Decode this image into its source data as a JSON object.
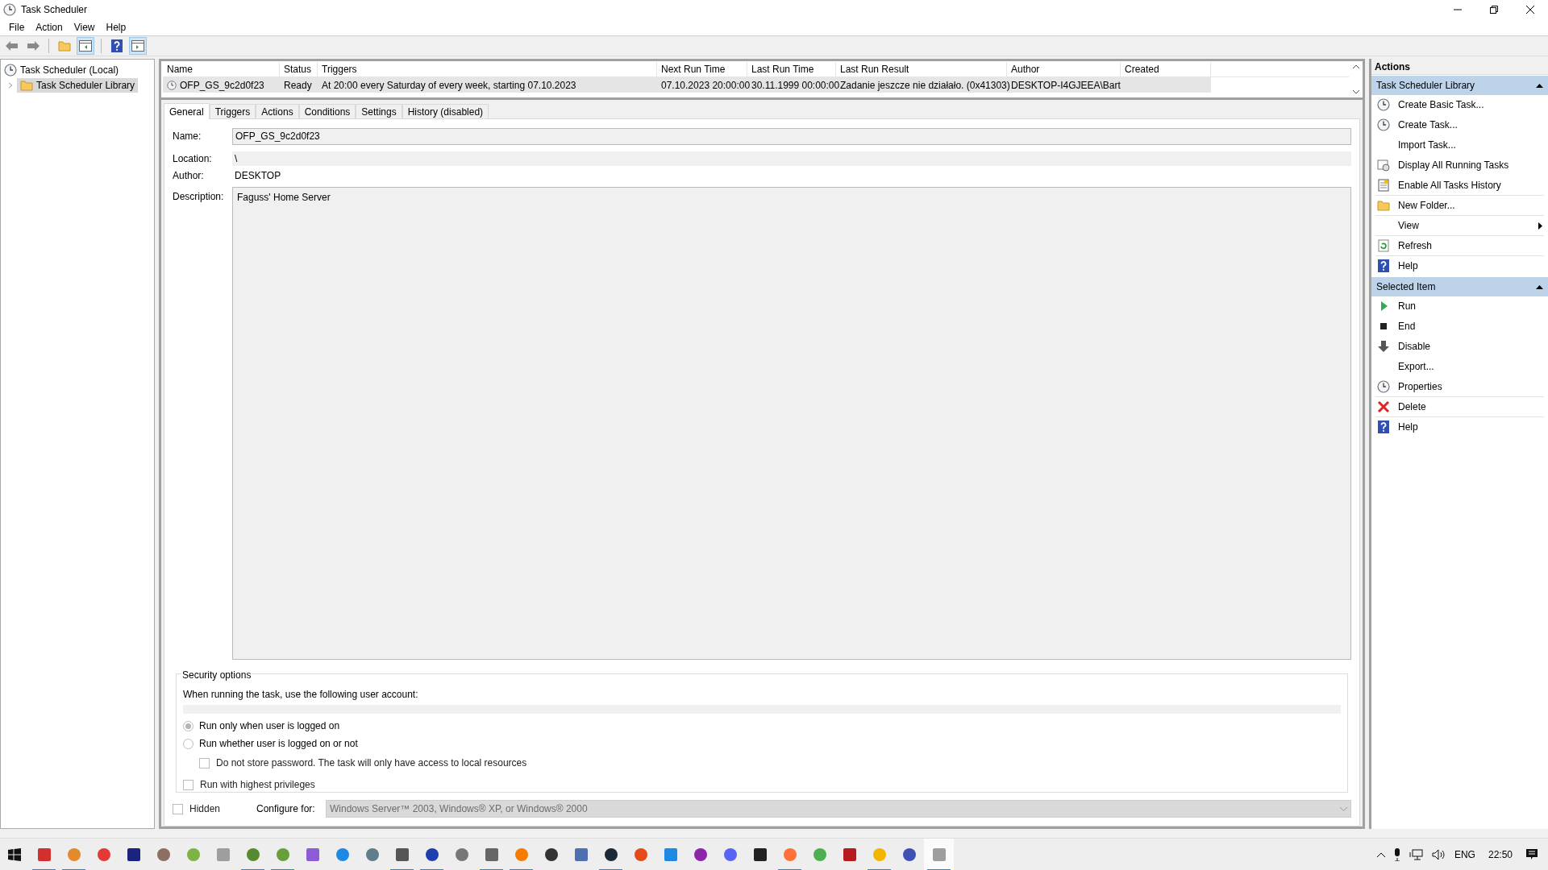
{
  "window": {
    "title": "Task Scheduler"
  },
  "menu": [
    "File",
    "Action",
    "View",
    "Help"
  ],
  "tree": {
    "label": "Task Scheduler (Local)",
    "children": [
      {
        "label": "Task Scheduler Library",
        "selected": true,
        "expanded": false
      }
    ]
  },
  "table": {
    "columns": [
      "Name",
      "Status",
      "Triggers",
      "Next Run Time",
      "Last Run Time",
      "Last Run Result",
      "Author",
      "Created"
    ],
    "rows": [
      {
        "selected": true,
        "cells": [
          "OFP_GS_9c2d0f23",
          "Ready",
          "At 20:00 every Saturday of every week, starting 07.10.2023",
          "07.10.2023 20:00:00",
          "30.11.1999 00:00:00",
          "Zadanie jeszcze nie działało. (0x41303)",
          "DESKTOP-I4GJEEA\\Bart"
        ]
      }
    ]
  },
  "tabs": [
    {
      "label": "General",
      "selected": true
    },
    {
      "label": "Triggers",
      "selected": false
    },
    {
      "label": "Actions",
      "selected": false
    },
    {
      "label": "Conditions",
      "selected": false
    },
    {
      "label": "Settings",
      "selected": false
    },
    {
      "label": "History (disabled)",
      "selected": false
    }
  ],
  "general": {
    "name_label": "Name:",
    "name": "OFP_GS_9c2d0f23",
    "location_label": "Location:",
    "location": "\\",
    "author_label": "Author:",
    "author": "DESKTOP",
    "description_label": "Description:",
    "description": "Faguss' Home Server",
    "security": {
      "title": "Security options",
      "account_label": "When running the task, use the following user account:",
      "radios": [
        {
          "label": "Run only when user is logged on",
          "selected": true
        },
        {
          "label": "Run whether user is logged on or not",
          "selected": false
        }
      ],
      "store_password": {
        "label": "Do not store password.  The task will only have access to local resources",
        "checked": false
      },
      "highest": {
        "label": "Run with highest privileges",
        "checked": false
      }
    },
    "hidden": {
      "label": "Hidden",
      "checked": false
    },
    "configure_label": "Configure for:",
    "configure": "Windows Server™ 2003, Windows® XP, or Windows® 2000"
  },
  "actions": {
    "title": "Actions",
    "sections": [
      {
        "title": "Task Scheduler Library",
        "expanded": true,
        "items": [
          {
            "label": "Create Basic Task...",
            "kind": "wizard",
            "divider": false
          },
          {
            "label": "Create Task...",
            "kind": "task",
            "divider": false
          },
          {
            "label": "Import Task...",
            "kind": "plain",
            "divider": false
          },
          {
            "label": "Display All Running Tasks",
            "kind": "running",
            "divider": false
          },
          {
            "label": "Enable All Tasks History",
            "kind": "history",
            "divider": true
          },
          {
            "label": "New Folder...",
            "kind": "folder",
            "divider": true
          },
          {
            "label": "View",
            "kind": "submenu",
            "divider": true
          },
          {
            "label": "Refresh",
            "kind": "refresh",
            "divider": true
          },
          {
            "label": "Help",
            "kind": "help",
            "divider": false
          }
        ]
      },
      {
        "title": "Selected Item",
        "expanded": true,
        "items": [
          {
            "label": "Run",
            "kind": "run",
            "divider": false
          },
          {
            "label": "End",
            "kind": "end",
            "divider": false
          },
          {
            "label": "Disable",
            "kind": "disable",
            "divider": false
          },
          {
            "label": "Export...",
            "kind": "plain",
            "divider": false
          },
          {
            "label": "Properties",
            "kind": "properties",
            "divider": true
          },
          {
            "label": "Delete",
            "kind": "delete",
            "divider": true
          },
          {
            "label": "Help",
            "kind": "help",
            "divider": false
          }
        ]
      }
    ]
  },
  "taskbar": {
    "apps": [
      {
        "running": true,
        "selected": false
      },
      {
        "running": true,
        "selected": false
      },
      {
        "running": false,
        "selected": false
      },
      {
        "running": false,
        "selected": false
      },
      {
        "running": false,
        "selected": false
      },
      {
        "running": false,
        "selected": false
      },
      {
        "running": false,
        "selected": false
      },
      {
        "running": true,
        "selected": false
      },
      {
        "running": true,
        "selected": false
      },
      {
        "running": false,
        "selected": false
      },
      {
        "running": false,
        "selected": false
      },
      {
        "running": false,
        "selected": false
      },
      {
        "running": true,
        "selected": false
      },
      {
        "running": true,
        "selected": false
      },
      {
        "running": false,
        "selected": false
      },
      {
        "running": true,
        "selected": false
      },
      {
        "running": true,
        "selected": false
      },
      {
        "running": false,
        "selected": false
      },
      {
        "running": false,
        "selected": false
      },
      {
        "running": true,
        "selected": false
      },
      {
        "running": false,
        "selected": false
      },
      {
        "running": false,
        "selected": false
      },
      {
        "running": false,
        "selected": false
      },
      {
        "running": false,
        "selected": false
      },
      {
        "running": false,
        "selected": false
      },
      {
        "running": true,
        "selected": false
      },
      {
        "running": false,
        "selected": false
      },
      {
        "running": false,
        "selected": false
      },
      {
        "running": true,
        "selected": false
      },
      {
        "running": false,
        "selected": false
      },
      {
        "running": true,
        "selected": true
      }
    ],
    "language": "ENG",
    "time": "22:50"
  }
}
